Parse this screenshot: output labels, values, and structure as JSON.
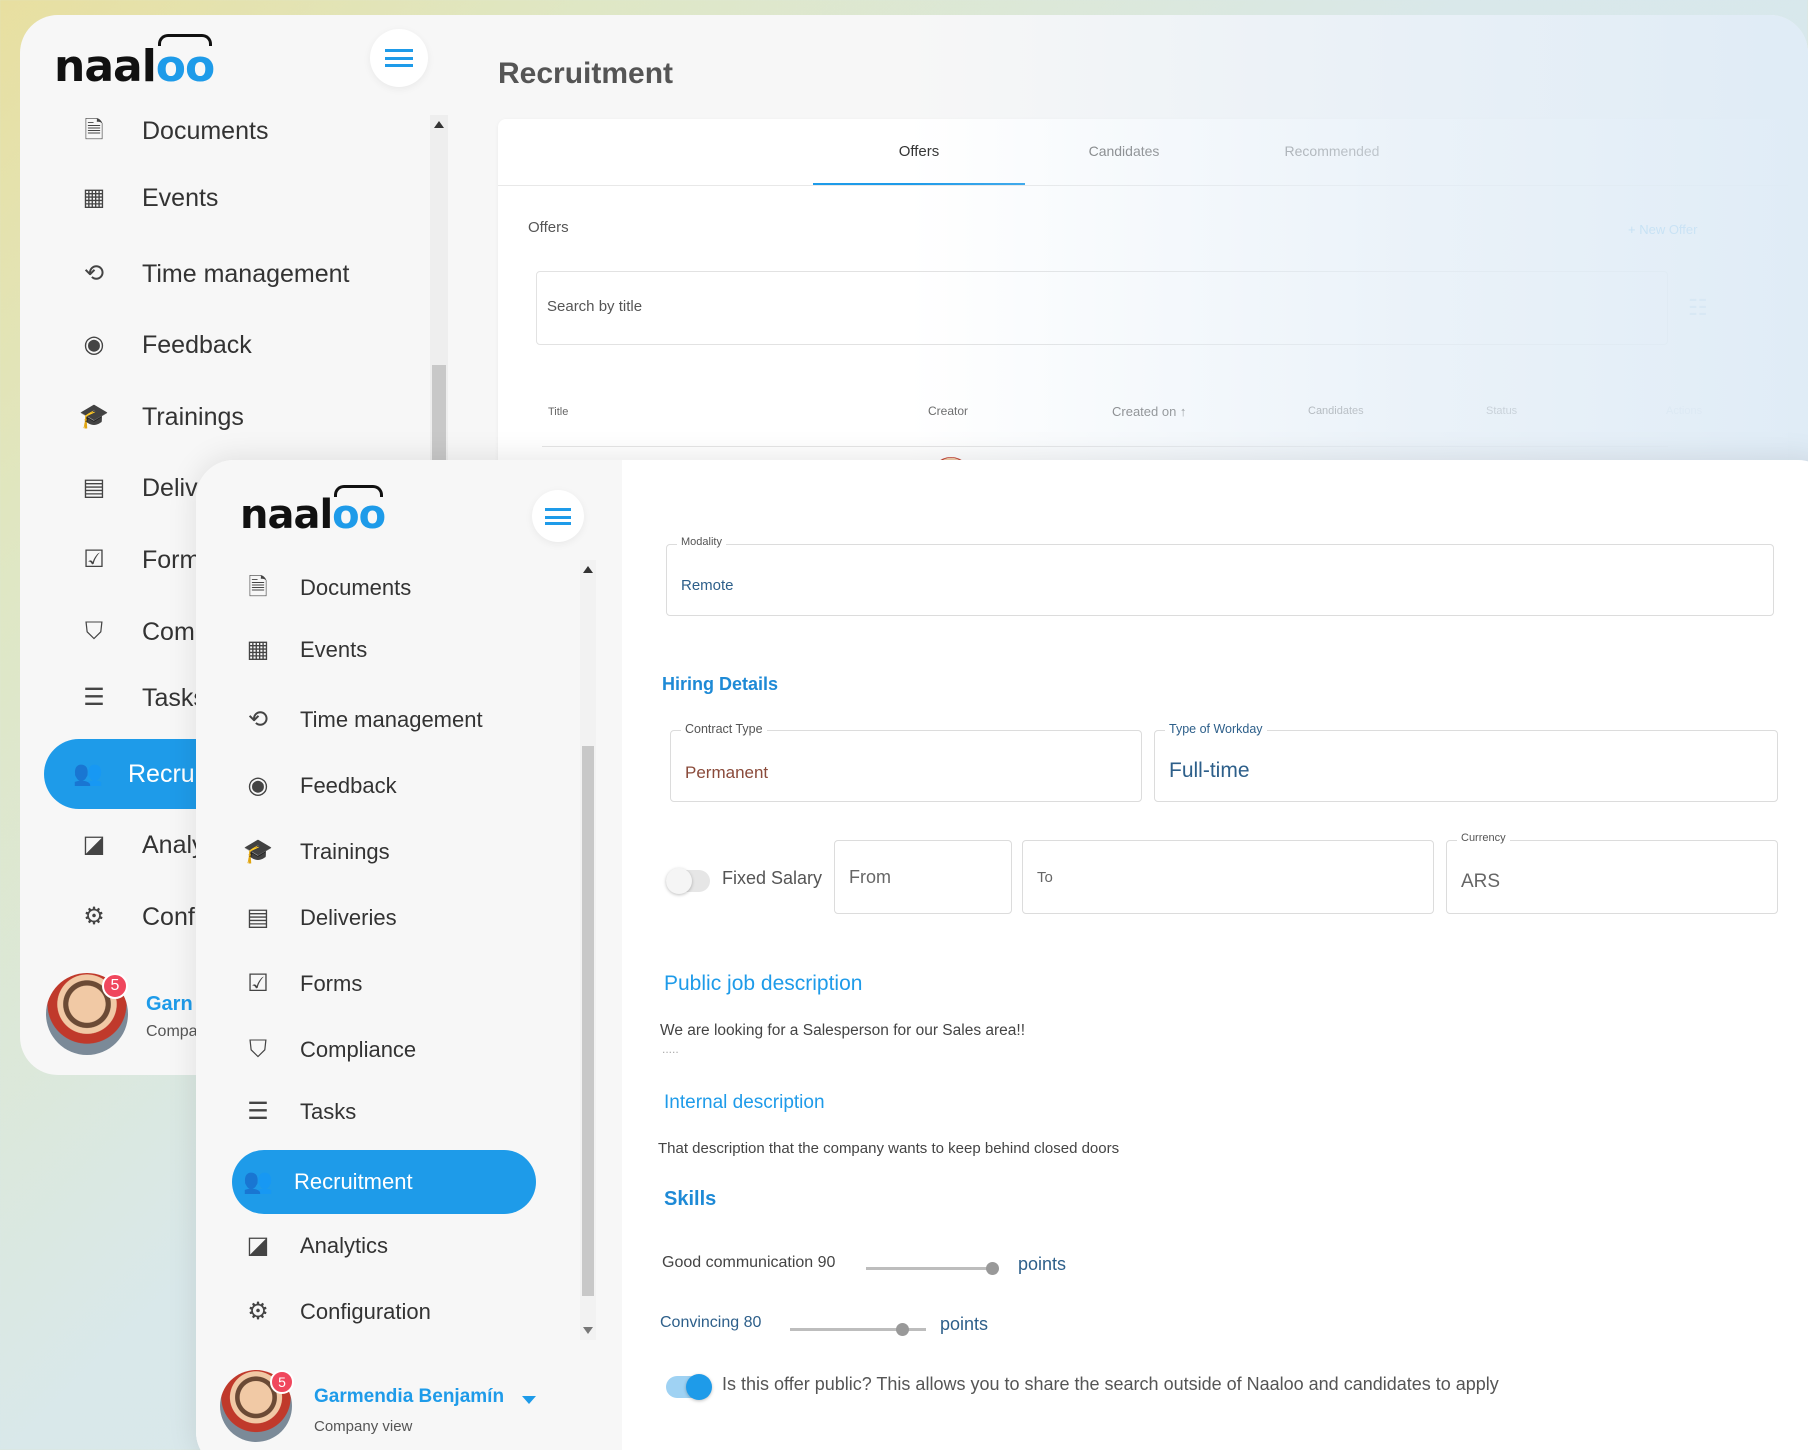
{
  "brand": {
    "logo_prefix": "naal",
    "logo_suffix": "oo",
    "accent": "#1e9be9"
  },
  "back_window": {
    "page_title": "Recruitment",
    "nav": [
      {
        "label": "Documents",
        "icon": "document-icon"
      },
      {
        "label": "Events",
        "icon": "calendar-icon"
      },
      {
        "label": "Time management",
        "icon": "clock-icon"
      },
      {
        "label": "Feedback",
        "icon": "feedback-icon"
      },
      {
        "label": "Trainings",
        "icon": "graduation-cap-icon"
      },
      {
        "label": "Deliveri",
        "icon": "archive-icon"
      },
      {
        "label": "Forms",
        "icon": "checklist-icon"
      },
      {
        "label": "Compl",
        "icon": "shield-icon"
      },
      {
        "label": "Tasks",
        "icon": "list-icon"
      },
      {
        "label": "Recrui",
        "icon": "people-search-icon"
      },
      {
        "label": "Analyti",
        "icon": "chart-icon"
      },
      {
        "label": "Config",
        "icon": "gear-icon"
      }
    ],
    "user": {
      "name": "Garn",
      "role": "Compa",
      "notifications": "5"
    },
    "tabs": [
      "Offers",
      "Candidates",
      "Recommended"
    ],
    "offers_heading": "Offers",
    "new_offer": "+ New Offer",
    "search_placeholder": "Search by title",
    "table_headers": [
      "Title",
      "Creator",
      "Created on ↑",
      "Candidates",
      "Status",
      "Actions"
    ]
  },
  "front_window": {
    "nav": [
      {
        "label": "Documents",
        "icon": "document-icon"
      },
      {
        "label": "Events",
        "icon": "calendar-icon"
      },
      {
        "label": "Time management",
        "icon": "clock-icon"
      },
      {
        "label": "Feedback",
        "icon": "feedback-icon"
      },
      {
        "label": "Trainings",
        "icon": "graduation-cap-icon"
      },
      {
        "label": "Deliveries",
        "icon": "archive-icon"
      },
      {
        "label": "Forms",
        "icon": "checklist-icon"
      },
      {
        "label": "Compliance",
        "icon": "shield-icon"
      },
      {
        "label": "Tasks",
        "icon": "list-icon"
      },
      {
        "label": "Recruitment",
        "icon": "people-search-icon"
      },
      {
        "label": "Analytics",
        "icon": "chart-icon"
      },
      {
        "label": "Configuration",
        "icon": "gear-icon"
      }
    ],
    "user": {
      "name": "Garmendia Benjamín",
      "role": "Company view",
      "notifications": "5"
    },
    "modality": {
      "label": "Modality",
      "value": "Remote"
    },
    "hiring_details_title": "Hiring Details",
    "contract_type": {
      "label": "Contract Type",
      "value": "Permanent"
    },
    "workday": {
      "label": "Type of Workday",
      "value": "Full-time"
    },
    "salary": {
      "toggle_label": "Fixed Salary",
      "from": "From",
      "to": "To",
      "currency_label": "Currency",
      "currency": "ARS",
      "fixed": false
    },
    "public_desc_title": "Public job description",
    "public_desc": "We are looking for a Salesperson for our Sales area!!",
    "public_desc_more": ".....",
    "internal_desc_title": "Internal description",
    "internal_desc": "That description that the company wants to keep behind closed doors",
    "skills_title": "Skills",
    "skills": [
      {
        "label": "Good communication 90",
        "unit": "points",
        "level": 0.9
      },
      {
        "label": "Convincing 80",
        "unit": "points",
        "level": 0.8
      }
    ],
    "public_offer_text": "Is this offer public? This allows you to share the search outside of Naaloo and candidates to apply",
    "public_offer": true
  }
}
